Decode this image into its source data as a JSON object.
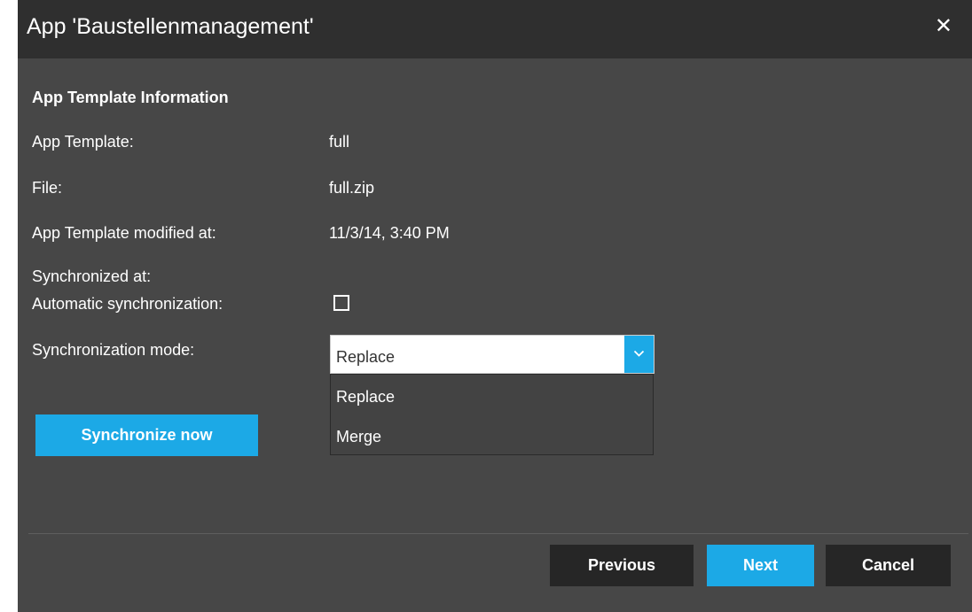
{
  "dialog": {
    "title": "App 'Baustellenmanagement'",
    "close_icon": "close-icon",
    "close_glyph": "✕"
  },
  "info": {
    "section_title": "App Template Information",
    "fields": [
      {
        "label": "App Template:",
        "value": "full"
      },
      {
        "label": "File:",
        "value": "full.zip"
      },
      {
        "label": "App Template modified at:",
        "value": "11/3/14, 3:40 PM"
      },
      {
        "label": "Synchronized at:",
        "value": ""
      }
    ],
    "auto_sync_label": "Automatic synchronization:",
    "auto_sync_checked": false,
    "sync_mode_label": "Synchronization mode:",
    "sync_mode_value": "Replace",
    "sync_mode_options": [
      "Replace",
      "Merge"
    ],
    "chevron_icon": "chevron-down-icon"
  },
  "actions": {
    "sync_now": "Synchronize now",
    "previous": "Previous",
    "next": "Next",
    "cancel": "Cancel"
  },
  "colors": {
    "accent": "#1ca9e6",
    "dialog_bg": "#474747",
    "titlebar_bg": "#2f2f2f",
    "dark_button": "#262626"
  }
}
